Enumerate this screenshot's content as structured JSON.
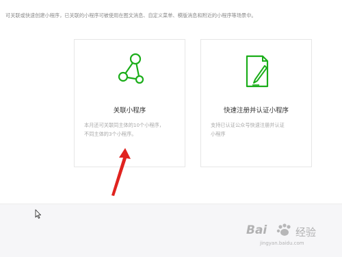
{
  "intro": {
    "text": "可关联或快速创建小程序，已关联的小程序可被使用在图文消息、自定义菜单、模版消息和附近的小程序等场景中。"
  },
  "cards": [
    {
      "title": "关联小程序",
      "desc_lines": [
        "本月还可关联同主体的10个小程序，",
        "不同主体的3个小程序。"
      ],
      "icon": "network-link-icon"
    },
    {
      "title": "快速注册并认证小程序",
      "desc_lines": [
        "支持已认证公众号快速注册并认证",
        "小程序"
      ],
      "icon": "document-pen-icon"
    }
  ],
  "watermark": {
    "brand_a": "Bai",
    "brand_b": "经验",
    "url": "jingyan.baidu.com"
  },
  "colors": {
    "accent_green": "#1aad19",
    "annotation_red": "#e0231f"
  }
}
